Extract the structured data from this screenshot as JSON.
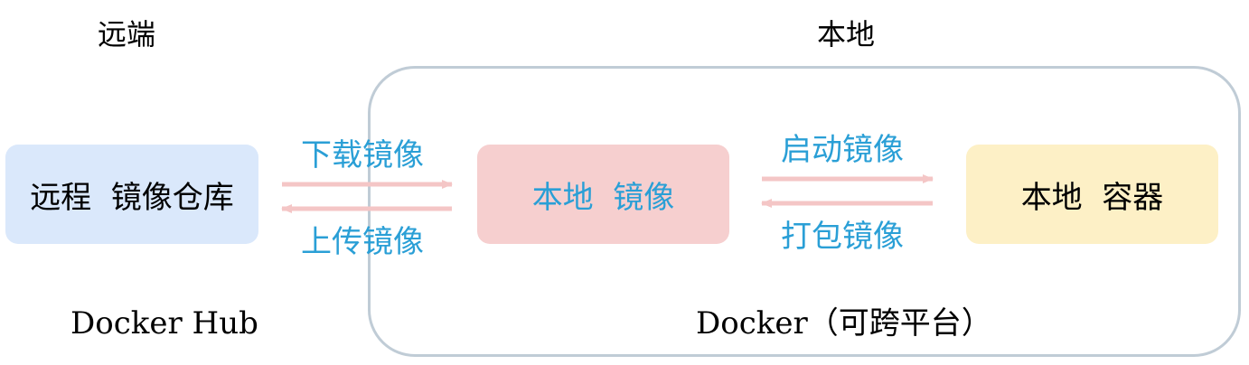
{
  "headings": {
    "remote": "远端",
    "local": "本地"
  },
  "nodes": {
    "remote_repo": "远程  镜像仓库",
    "local_image": "本地  镜像",
    "local_container": "本地  容器"
  },
  "edges": {
    "pull": "下载镜像",
    "push": "上传镜像",
    "run": "启动镜像",
    "commit": "打包镜像"
  },
  "captions": {
    "hub": "Docker Hub",
    "docker": "Docker（可跨平台）"
  },
  "colors": {
    "remote_box": "#dae8fb",
    "image_box": "#f6cfcf",
    "container_box": "#fdf0c6",
    "arrow": "#f4c6c6",
    "edge_text": "#2a9fd6",
    "frame": "#c0ccd6"
  }
}
